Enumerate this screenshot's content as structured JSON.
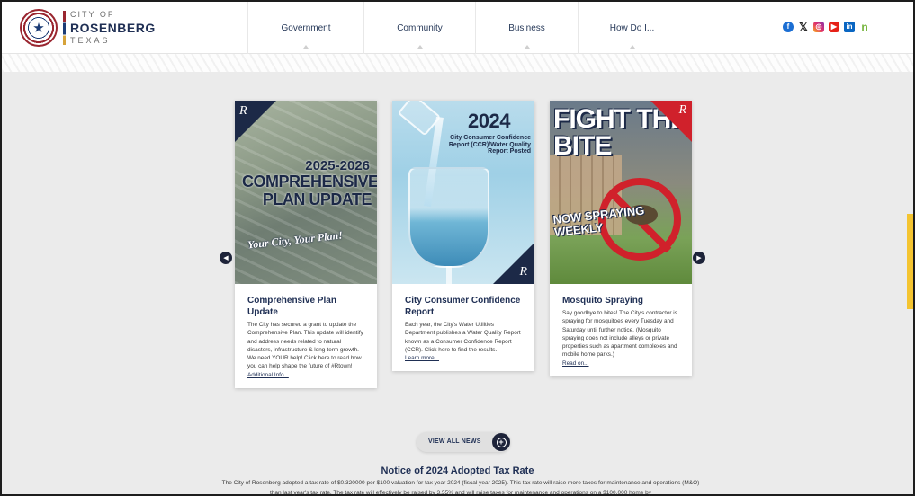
{
  "logo": {
    "line1": "CITY OF",
    "line2": "ROSENBERG",
    "line3": "TEXAS"
  },
  "nav": [
    {
      "label": "Government"
    },
    {
      "label": "Community"
    },
    {
      "label": "Business"
    },
    {
      "label": "How Do I..."
    }
  ],
  "social": {
    "facebook": "f",
    "x": "𝕏",
    "instagram": "◎",
    "youtube": "▶",
    "linkedin": "in",
    "nextdoor": "n"
  },
  "cards": [
    {
      "img_text": [
        "2025-2026",
        "COMPREHENSIVE PLAN UPDATE",
        "Your City, Your Plan!"
      ],
      "title": "Comprehensive Plan Update",
      "text": "The City has secured a grant to update the Comprehensive Plan. This update will identify and address needs related to natural disasters, infrastructure & long-term growth. We need YOUR help! Click here to read how you can help shape the future of #Rtown!",
      "link": "Additional Info..."
    },
    {
      "img_text": [
        "2024",
        "City Consumer Confidence Report (CCR)/Water Quality Report Posted"
      ],
      "title": "City Consumer Confidence Report",
      "text": "Each year, the City's Water Utilities Department publishes a Water Quality Report known as a Consumer Confidence Report (CCR). Click here to find the results.",
      "link": "Learn more..."
    },
    {
      "img_text": [
        "FIGHT THE BITE",
        "NOW SPRAYING WEEKLY"
      ],
      "title": "Mosquito Spraying",
      "text": "Say goodbye to bites! The City's contractor is spraying for mosquitoes every Tuesday and Saturday until further notice. (Mosquito spraying does not include alleys or private properties such as apartment complexes and mobile home parks.)",
      "link": "Read on..."
    }
  ],
  "brand_mark": "R",
  "view_all": {
    "label": "VIEW ALL NEWS"
  },
  "notice": {
    "title": "Notice of 2024 Adopted Tax Rate",
    "text": "The City of Rosenberg adopted a tax rate of $0.320000 per $100 valuation for tax year 2024 (fiscal year 2025). This tax rate will raise more taxes for maintenance and operations (M&O) than last year's tax rate. The tax rate will effectively be raised by 3.55% and will raise taxes for maintenance and operations on a $100,000 home by"
  },
  "colors": {
    "navy": "#1f2f54",
    "red": "#d0212b",
    "accent": "#f4c430"
  }
}
